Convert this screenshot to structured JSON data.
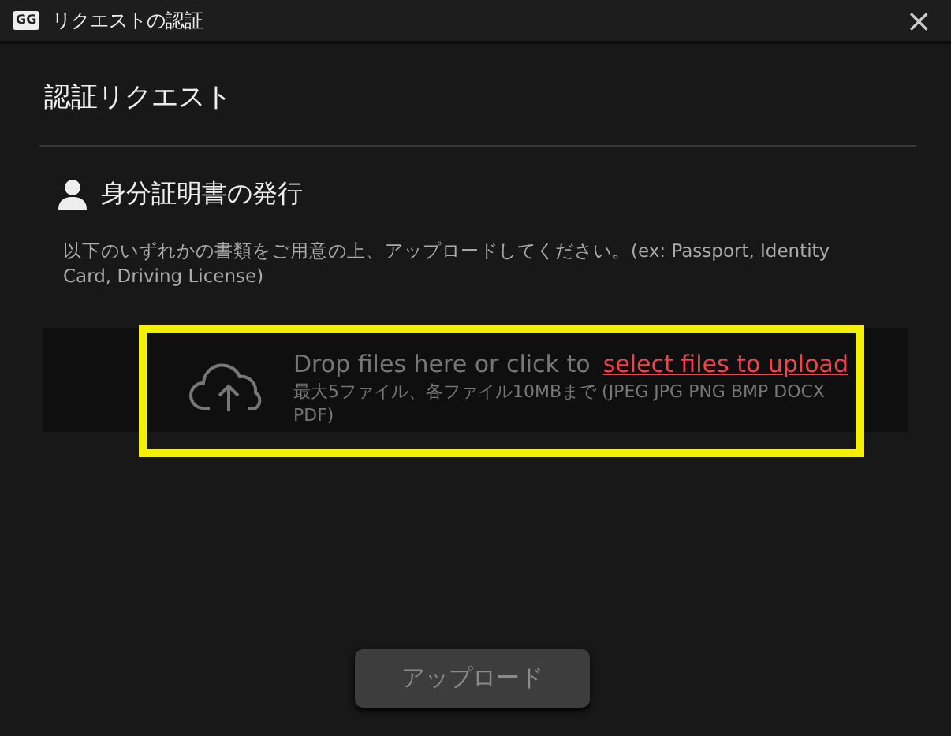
{
  "window": {
    "title": "リクエストの認証",
    "logo": "GG",
    "close": "×"
  },
  "heading": "認証リクエスト",
  "section": {
    "title": "身分証明書の発行",
    "description": "以下のいずれかの書類をご用意の上、アップロードしてください。(ex: Passport, Identity Card, Driving License)"
  },
  "dropzone": {
    "prompt": "Drop files here or click to",
    "link": "select files to upload",
    "limits": "最大5ファイル、各ファイル10MBまで (JPEG JPG PNG BMP DOCX PDF)",
    "highlighted": true
  },
  "upload_button": {
    "label": "アップロード",
    "disabled": true
  }
}
